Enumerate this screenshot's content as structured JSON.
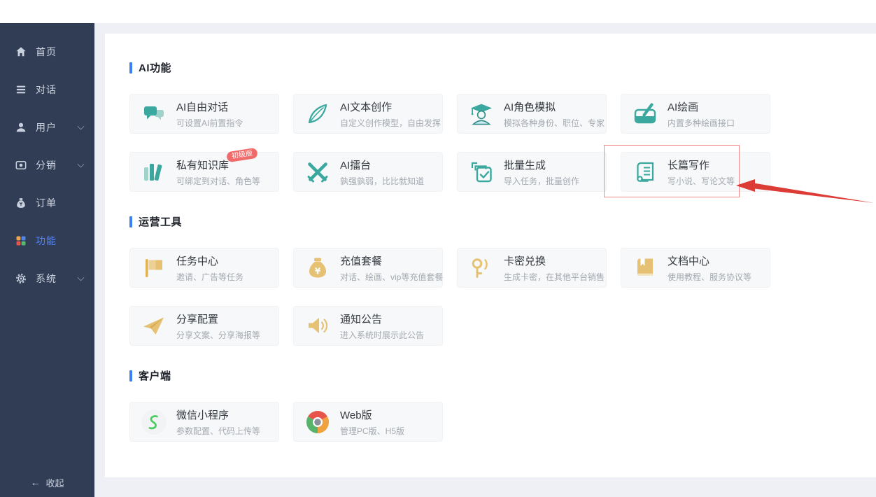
{
  "sidebar": {
    "items": [
      {
        "label": "首页",
        "icon": "home-icon",
        "chevron": false,
        "active": false
      },
      {
        "label": "对话",
        "icon": "chat-list-icon",
        "chevron": false,
        "active": false
      },
      {
        "label": "用户",
        "icon": "user-icon",
        "chevron": true,
        "active": false
      },
      {
        "label": "分销",
        "icon": "distribution-icon",
        "chevron": true,
        "active": false
      },
      {
        "label": "订单",
        "icon": "order-icon",
        "chevron": false,
        "active": false
      },
      {
        "label": "功能",
        "icon": "features-grid-icon",
        "chevron": false,
        "active": true
      },
      {
        "label": "系统",
        "icon": "system-gear-icon",
        "chevron": true,
        "active": false
      }
    ],
    "collapse_arrow": "←",
    "collapse_label": "收起"
  },
  "sections": [
    {
      "title": "AI功能",
      "cards": [
        {
          "title": "AI自由对话",
          "subtitle": "可设置AI前置指令",
          "icon": "chat-bubbles-icon"
        },
        {
          "title": "AI文本创作",
          "subtitle": "自定义创作模型，自由发挥",
          "icon": "feather-icon"
        },
        {
          "title": "AI角色模拟",
          "subtitle": "模拟各种身份、职位、专家",
          "icon": "graduate-icon"
        },
        {
          "title": "AI绘画",
          "subtitle": "内置多种绘画接口",
          "icon": "paint-icon"
        },
        {
          "title": "私有知识库",
          "subtitle": "可绑定到对话、角色等",
          "icon": "books-icon",
          "badge": "初级版"
        },
        {
          "title": "AI擂台",
          "subtitle": "孰强孰弱，比比就知道",
          "icon": "swords-icon"
        },
        {
          "title": "批量生成",
          "subtitle": "导入任务，批量创作",
          "icon": "batch-icon"
        },
        {
          "title": "长篇写作",
          "subtitle": "写小说、写论文等",
          "icon": "long-writing-icon",
          "annotated": true
        }
      ]
    },
    {
      "title": "运营工具",
      "cards": [
        {
          "title": "任务中心",
          "subtitle": "邀请、广告等任务",
          "icon": "flag-icon"
        },
        {
          "title": "充值套餐",
          "subtitle": "对话、绘画、vip等充值套餐",
          "icon": "moneybag-icon"
        },
        {
          "title": "卡密兑换",
          "subtitle": "生成卡密，在其他平台销售",
          "icon": "key-icon"
        },
        {
          "title": "文档中心",
          "subtitle": "使用教程、服务协议等",
          "icon": "doc-icon"
        },
        {
          "title": "分享配置",
          "subtitle": "分享文案、分享海报等",
          "icon": "share-plane-icon"
        },
        {
          "title": "通知公告",
          "subtitle": "进入系统时展示此公告",
          "icon": "announce-icon"
        }
      ]
    },
    {
      "title": "客户端",
      "cards": [
        {
          "title": "微信小程序",
          "subtitle": "参数配置、代码上传等",
          "icon": "wechat-mini-icon"
        },
        {
          "title": "Web版",
          "subtitle": "管理PC版、H5版",
          "icon": "chrome-icon"
        }
      ]
    }
  ],
  "colors": {
    "sidebar_bg": "#313d55",
    "active_blue": "#5585f2",
    "section_bar_blue": "#3d7ff7",
    "teal": "#3aa89e",
    "teal_light": "#9fd3cc",
    "gold": "#e6c173",
    "badge_red": "#f16a6a",
    "annotation_red": "#dd3b35"
  }
}
